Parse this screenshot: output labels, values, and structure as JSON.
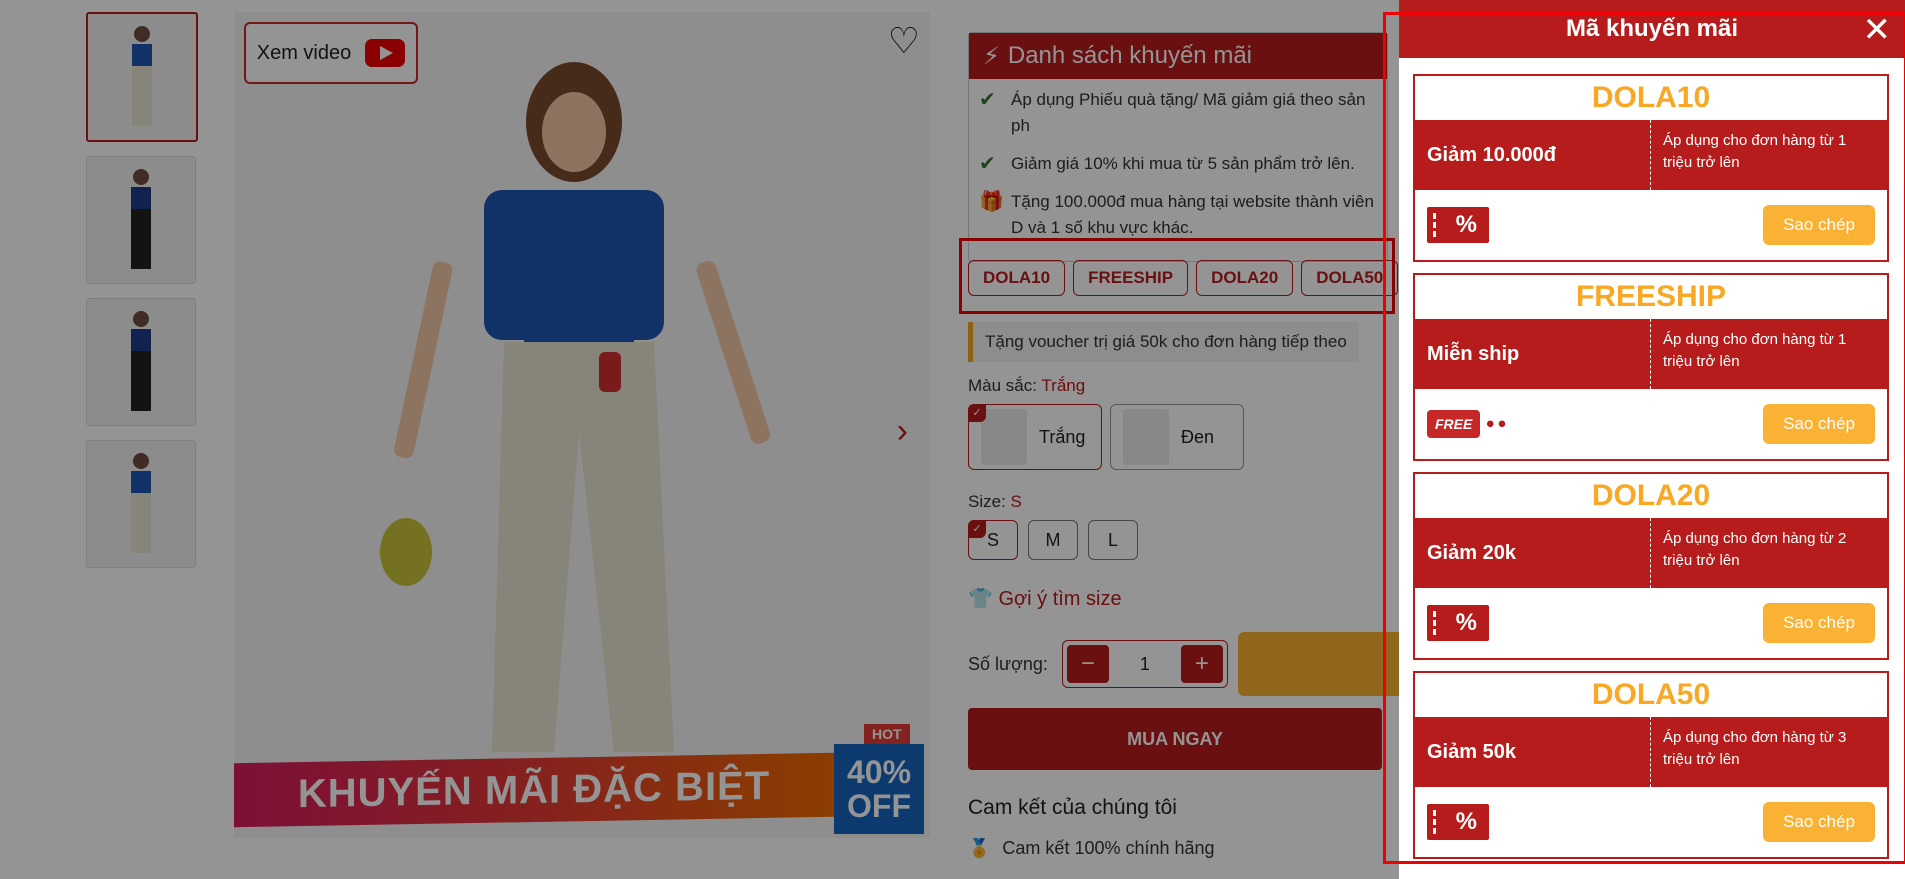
{
  "video": {
    "label": "Xem video"
  },
  "banner": {
    "text": "KHUYẾN MÃI ĐẶC BIỆT",
    "hot": "HOT",
    "off_top": "40%",
    "off_bottom": "OFF"
  },
  "promo": {
    "title": "Danh sách khuyến mãi",
    "items": [
      "Áp dụng Phiếu quà tặng/ Mã giảm giá theo sản ph",
      "Giảm giá 10% khi mua từ 5 sản phẩm trở lên.",
      "Tặng 100.000đ mua hàng tại website thành viên D và 1 số khu vực khác."
    ]
  },
  "codes": [
    "DOLA10",
    "FREESHIP",
    "DOLA20",
    "DOLA50"
  ],
  "voucher_note": "Tặng voucher trị giá 50k cho đơn hàng tiếp theo",
  "color": {
    "label": "Màu sắc:",
    "selected": "Trắng",
    "options": [
      "Trắng",
      "Đen"
    ]
  },
  "size": {
    "label": "Size:",
    "selected": "S",
    "options": [
      "S",
      "M",
      "L"
    ]
  },
  "size_guide": "Gợi ý tìm size",
  "quantity": {
    "label": "Số lượng:",
    "value": "1",
    "minus": "−",
    "plus": "+"
  },
  "buy_now": "MUA NGAY",
  "commit": {
    "title": "Cam kết của chúng tôi",
    "item1": "Cam kết 100% chính hãng"
  },
  "panel": {
    "title": "Mã khuyến mãi",
    "copy_label": "Sao chép",
    "coupons": [
      {
        "code": "DOLA10",
        "value": "Giảm 10.000đ",
        "condition": "Áp dụng cho đơn hàng từ 1 triệu trở lên",
        "icon": "ticket-percent-icon"
      },
      {
        "code": "FREESHIP",
        "value": "Miễn ship",
        "condition": "Áp dụng cho đơn hàng từ 1 triệu trở lên",
        "icon": "free-truck-icon"
      },
      {
        "code": "DOLA20",
        "value": "Giảm 20k",
        "condition": "Áp dụng cho đơn hàng từ 2 triệu trở lên",
        "icon": "ticket-percent-icon"
      },
      {
        "code": "DOLA50",
        "value": "Giảm 50k",
        "condition": "Áp dụng cho đơn hàng từ 3 triệu trở lên",
        "icon": "ticket-percent-icon"
      }
    ]
  },
  "icons": {
    "percent": "%",
    "free": "FREE"
  }
}
